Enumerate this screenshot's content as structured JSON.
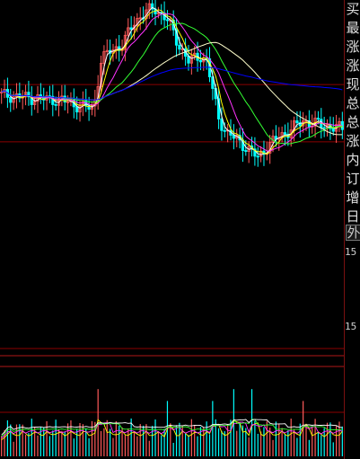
{
  "side_labels": [
    "买",
    "最",
    "涨",
    "涨",
    "现",
    "总",
    "总",
    "涨",
    "内",
    "订",
    "增",
    "日"
  ],
  "side_highlight": "外",
  "side_numbers": [
    "15",
    "15"
  ],
  "colors": {
    "background": "#000000",
    "grid": "#8b0000",
    "up_candle": "#ff5a5a",
    "down_candle": "#00ffff",
    "ma_white": "#ffffff",
    "ma_yellow": "#ffff00",
    "ma_magenta": "#ff33ff",
    "ma_green": "#33ff33",
    "ma_cream": "#ffffcc",
    "ma_blue": "#0000ff"
  },
  "chart_data": {
    "type": "candlestick",
    "bar_count": 114,
    "price_range": [
      0,
      100
    ],
    "ref_lines": [
      {
        "value": 71
      },
      {
        "value": 49
      },
      {
        "value": 6
      }
    ],
    "price_keys": [
      {
        "i": 0,
        "p": 67
      },
      {
        "i": 8,
        "p": 66
      },
      {
        "i": 20,
        "p": 65
      },
      {
        "i": 25,
        "p": 63
      },
      {
        "i": 30,
        "p": 62
      },
      {
        "i": 31,
        "p": 65
      },
      {
        "i": 33,
        "p": 80
      },
      {
        "i": 36,
        "p": 84
      },
      {
        "i": 40,
        "p": 86
      },
      {
        "i": 44,
        "p": 95
      },
      {
        "i": 48,
        "p": 99
      },
      {
        "i": 51,
        "p": 100
      },
      {
        "i": 55,
        "p": 96
      },
      {
        "i": 58,
        "p": 88
      },
      {
        "i": 62,
        "p": 80
      },
      {
        "i": 66,
        "p": 82
      },
      {
        "i": 68,
        "p": 80
      },
      {
        "i": 70,
        "p": 69
      },
      {
        "i": 72,
        "p": 58
      },
      {
        "i": 75,
        "p": 52
      },
      {
        "i": 78,
        "p": 50
      },
      {
        "i": 82,
        "p": 46
      },
      {
        "i": 85,
        "p": 43
      },
      {
        "i": 88,
        "p": 47
      },
      {
        "i": 92,
        "p": 51
      },
      {
        "i": 95,
        "p": 53
      },
      {
        "i": 100,
        "p": 57
      },
      {
        "i": 104,
        "p": 56
      },
      {
        "i": 108,
        "p": 55
      },
      {
        "i": 113,
        "p": 54
      }
    ],
    "moving_averages": [
      {
        "color": "#ffffff",
        "period": 3
      },
      {
        "color": "#ffff00",
        "period": 5
      },
      {
        "color": "#ff33ff",
        "period": 10
      },
      {
        "color": "#33ff33",
        "period": 20
      },
      {
        "color": "#ffffcc",
        "period": 40
      },
      {
        "color": "#0000ff",
        "period": 80
      }
    ],
    "volume_range": [
      0,
      100
    ],
    "volume_spike_indices": [
      32,
      55,
      70,
      77,
      83,
      100
    ],
    "volume_ma_colors": [
      "#ffff00",
      "#ff33ff",
      "#33ff33",
      "#ffffff"
    ]
  }
}
